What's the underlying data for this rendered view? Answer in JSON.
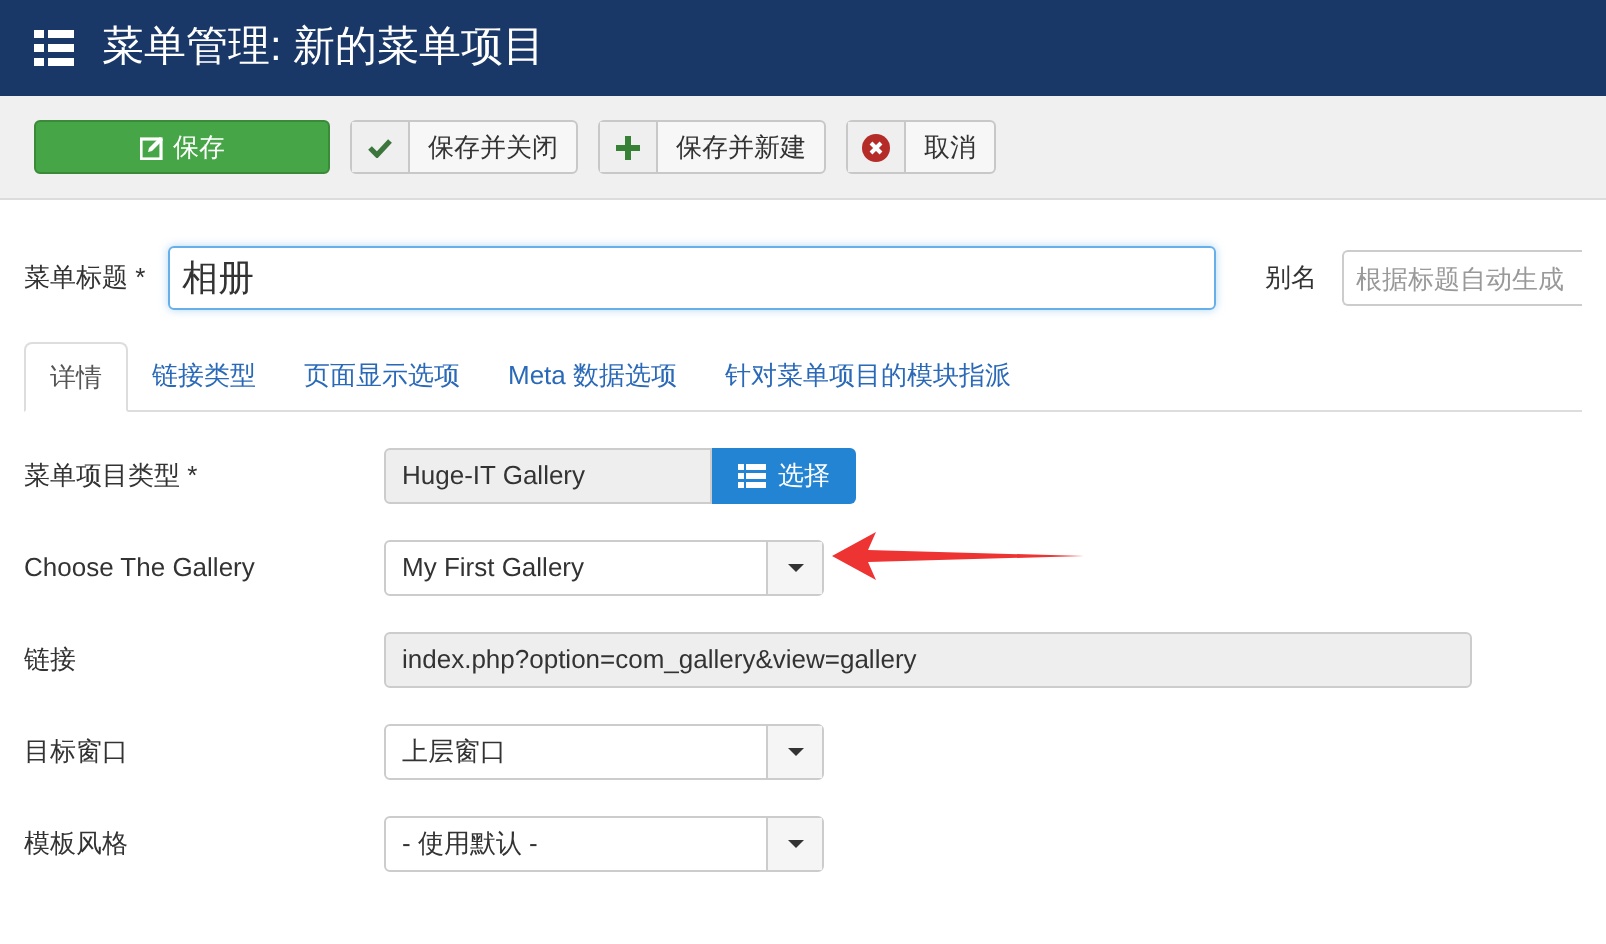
{
  "header": {
    "title": "菜单管理: 新的菜单项目"
  },
  "toolbar": [
    {
      "kind": "primary",
      "label": "保存"
    },
    {
      "kind": "check",
      "label": "保存并关闭"
    },
    {
      "kind": "plus",
      "label": "保存并新建"
    },
    {
      "kind": "cancel",
      "label": "取消"
    }
  ],
  "title_field": {
    "label": "菜单标题 *",
    "value": "相册"
  },
  "alias_field": {
    "label": "别名",
    "placeholder": "根据标题自动生成"
  },
  "tabs": [
    {
      "label": "详情",
      "selected": true
    },
    {
      "label": "链接类型",
      "selected": false
    },
    {
      "label": "页面显示选项",
      "selected": false
    },
    {
      "label": "Meta 数据选项",
      "selected": false
    },
    {
      "label": "针对菜单项目的模块指派",
      "selected": false
    }
  ],
  "fields": [
    {
      "kind": "chooser",
      "label": "菜单项目类型 *",
      "value": "Huge-IT  Gallery",
      "button": "选择"
    },
    {
      "kind": "select",
      "label": "Choose The Gallery",
      "value": "My First Gallery",
      "highlighted": true
    },
    {
      "kind": "readonly",
      "label": "链接",
      "value": "index.php?option=com_gallery&view=gallery"
    },
    {
      "kind": "select",
      "label": "目标窗口",
      "value": "上层窗口",
      "highlighted": false
    },
    {
      "kind": "select",
      "label": "模板风格",
      "value": "- 使用默认 -",
      "highlighted": false
    }
  ]
}
